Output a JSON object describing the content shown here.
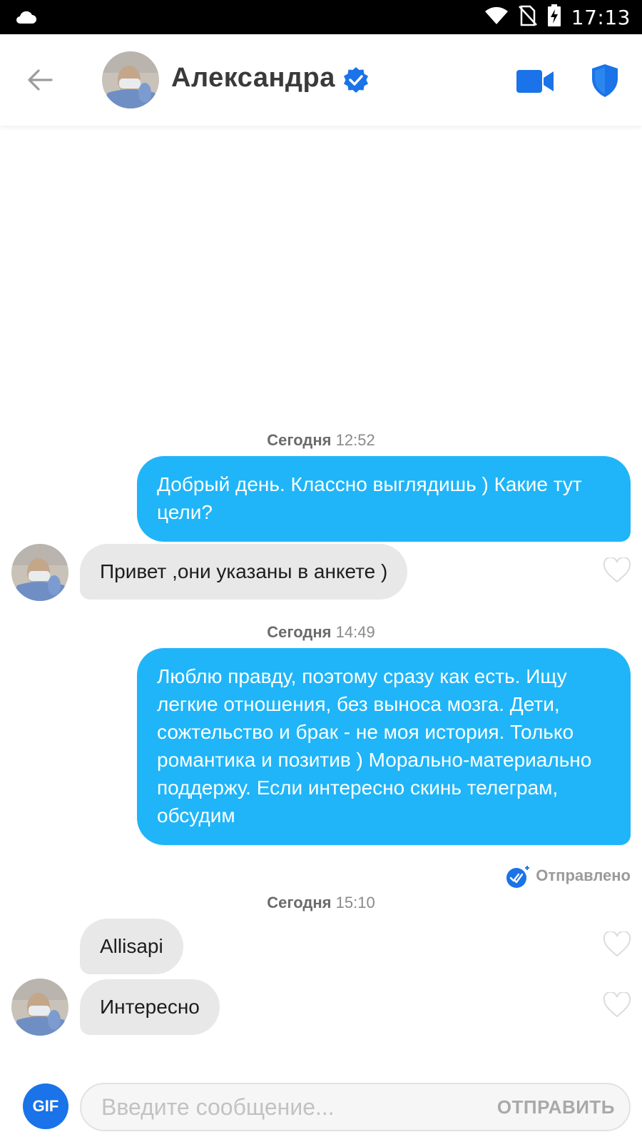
{
  "status_bar": {
    "time": "17:13",
    "icons": [
      "cloud-icon",
      "wifi-icon",
      "no-sim-icon",
      "battery-charging-icon"
    ]
  },
  "header": {
    "contact_name": "Александра",
    "verified": true,
    "actions": [
      "back-arrow-icon",
      "video-call-icon",
      "shield-icon"
    ]
  },
  "colors": {
    "outgoing_bubble": "#1fb5f8",
    "incoming_bubble": "#e8e8e8",
    "accent": "#1a73e8"
  },
  "messages": [
    {
      "type": "timestamp",
      "label": "Сегодня",
      "time": "12:52"
    },
    {
      "type": "outgoing",
      "text": "Добрый день. Классно выглядишь ) Какие тут цели?"
    },
    {
      "type": "incoming",
      "text": "Привет ,они указаны в анкете )"
    },
    {
      "type": "timestamp",
      "label": "Сегодня",
      "time": "14:49"
    },
    {
      "type": "outgoing",
      "text": "Люблю правду, поэтому сразу как есть. Ищу легкие отношения, без выноса мозга. Дети, сожтельство и брак - не моя история. Только романтика и позитив ) Морально-материально поддержу. Если интересно скинь телеграм, обсудим"
    },
    {
      "type": "status",
      "text": "Отправлено"
    },
    {
      "type": "timestamp",
      "label": "Сегодня",
      "time": "15:10"
    },
    {
      "type": "incoming",
      "text": "Allisapi"
    },
    {
      "type": "incoming",
      "text": "Интересно"
    }
  ],
  "composer": {
    "gif_label": "GIF",
    "placeholder": "Введите сообщение...",
    "send_label": "ОТПРАВИТЬ"
  }
}
